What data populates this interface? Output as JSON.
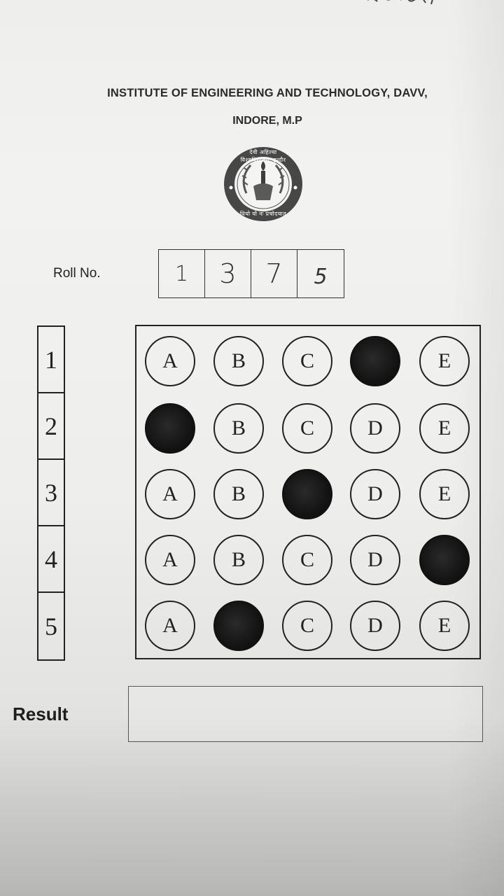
{
  "header": {
    "institute_line1": "INSTITUTE OF ENGINEERING AND TECHNOLOGY, DAVV,",
    "institute_line2": "INDORE, M.P",
    "seal_text_top": "देवी अहिल्या विश्वविद्यालय, इन्दौर",
    "seal_text_bottom": "धियो यो नः प्रचोदयात्"
  },
  "roll": {
    "label": "Roll No.",
    "digits": [
      "1",
      "3",
      "7",
      "5"
    ]
  },
  "answer_sheet": {
    "questions": [
      {
        "number": "1",
        "options": [
          "A",
          "B",
          "C",
          "D",
          "E"
        ],
        "marked": "D"
      },
      {
        "number": "2",
        "options": [
          "A",
          "B",
          "C",
          "D",
          "E"
        ],
        "marked": "A"
      },
      {
        "number": "3",
        "options": [
          "A",
          "B",
          "C",
          "D",
          "E"
        ],
        "marked": "C"
      },
      {
        "number": "4",
        "options": [
          "A",
          "B",
          "C",
          "D",
          "E"
        ],
        "marked": "E"
      },
      {
        "number": "5",
        "options": [
          "A",
          "B",
          "C",
          "D",
          "E"
        ],
        "marked": "B"
      }
    ]
  },
  "result": {
    "label": "Result",
    "value": ""
  },
  "colors": {
    "ink": "#222222",
    "paper": "#eeeeec",
    "seal": "#4a4a4a"
  }
}
